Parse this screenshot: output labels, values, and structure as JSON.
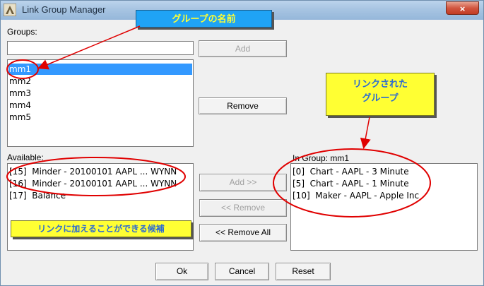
{
  "window": {
    "title": "Link Group Manager",
    "close_glyph": "×"
  },
  "groups": {
    "label": "Groups:",
    "input_value": "",
    "add_label": "Add",
    "remove_label": "Remove",
    "items": [
      "mm1",
      "mm2",
      "mm3",
      "mm4",
      "mm5"
    ],
    "selected": "mm1"
  },
  "available": {
    "label": "Available:",
    "items": [
      "[15]  Minder - 20100101 AAPL ... WYNN",
      "[16]  Minder - 20100101 AAPL ... WYNN",
      "[17]  Balance"
    ]
  },
  "in_group": {
    "label": "In Group:  mm1",
    "items": [
      "[0]  Chart - AAPL - 3 Minute",
      "[5]  Chart - AAPL - 1 Minute",
      "[10]  Maker - AAPL - Apple Inc"
    ]
  },
  "middle_buttons": {
    "add": "Add >>",
    "remove": "<< Remove",
    "remove_all": "<< Remove All"
  },
  "footer": {
    "ok": "Ok",
    "cancel": "Cancel",
    "reset": "Reset"
  },
  "annotations": {
    "group_name": "グループの名前",
    "linked_group": "リンクされた\nグループ",
    "candidates": "リンクに加えることができる候補"
  },
  "colors": {
    "selection": "#3399ff",
    "callout_blue": "#1fa3f5",
    "callout_yellow": "#ffff33",
    "annotation_red": "#e00000"
  }
}
